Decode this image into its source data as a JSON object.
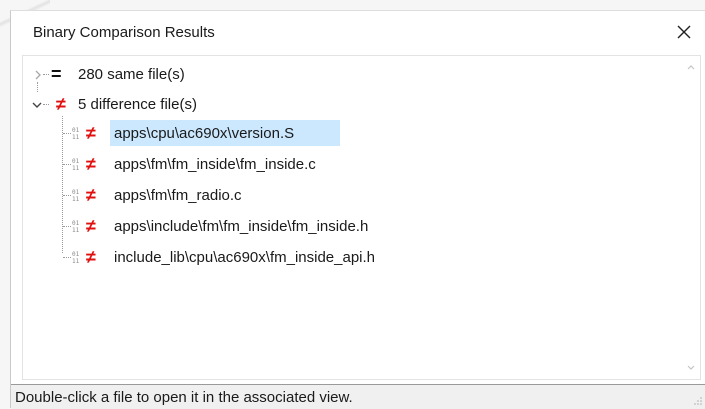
{
  "dialog": {
    "title": "Binary Comparison Results"
  },
  "tree": {
    "same_group": {
      "symbol": "=",
      "label": "280 same file(s)",
      "expanded": false
    },
    "diff_group": {
      "symbol": "≠",
      "label": "5 difference file(s)",
      "expanded": true
    },
    "files": [
      {
        "path": "apps\\cpu\\ac690x\\version.S",
        "selected": true
      },
      {
        "path": "apps\\fm\\fm_inside\\fm_inside.c",
        "selected": false
      },
      {
        "path": "apps\\fm\\fm_radio.c",
        "selected": false
      },
      {
        "path": "apps\\include\\fm\\fm_inside\\fm_inside.h",
        "selected": false
      },
      {
        "path": "include_lib\\cpu\\ac690x\\fm_inside_api.h",
        "selected": false
      }
    ],
    "file_symbol": "≠",
    "binary_icon_glyph": "01\n11"
  },
  "status": {
    "text": "Double-click a file to open it in the associated view."
  },
  "colors": {
    "selection": "#cce8ff",
    "diff_red": "#e01010"
  },
  "icons": {
    "close": "close-icon",
    "collapsed": "chevron-right-icon",
    "expanded": "chevron-down-icon",
    "binary": "binary-file-icon",
    "not_equal": "not-equal-icon",
    "equal": "equal-icon"
  }
}
